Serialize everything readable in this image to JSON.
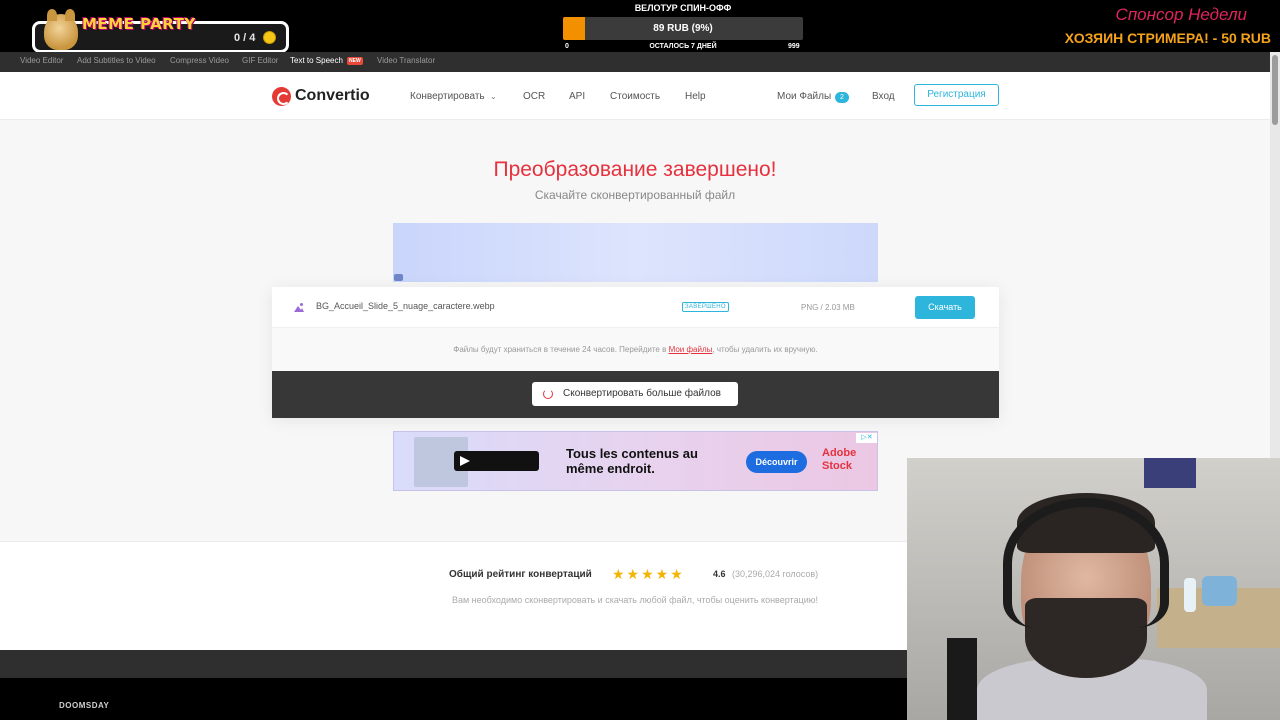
{
  "overlay": {
    "meme_title": "MEME PARTY",
    "meme_count": "0 / 4",
    "spin_title": "ВЕЛОТУР СПИН-ОФФ",
    "spin_text": "89 RUB (9%)",
    "spin_progress_fraction": 0.09,
    "spin_min": "0",
    "spin_remaining": "ОСТАЛОСЬ 7 ДНЕЙ",
    "spin_max": "999",
    "sponsor_title": "Спонсор Недели",
    "sponsor_text": "ХОЗЯИН СТРИМЕРА! - 50 RUB",
    "bottom_logo": "DOOMSDAY"
  },
  "subnav": {
    "items": [
      "Video Editor",
      "Add Subtitles to Video",
      "Compress Video",
      "GIF Editor",
      "Text to Speech",
      "Video Translator"
    ],
    "new_badge": "NEW",
    "active_item": "Text to Speech"
  },
  "header": {
    "logo": "Convertio",
    "nav": [
      "Конвертировать",
      "OCR",
      "API",
      "Стоимость",
      "Help"
    ],
    "my_files": "Мои Файлы",
    "my_files_count": "2",
    "login": "Вход",
    "register": "Регистрация"
  },
  "main": {
    "title": "Преобразование завершено!",
    "subtitle": "Скачайте сконвертированный файл"
  },
  "file": {
    "name": "BG_Accueil_Slide_5_nuage_caractere.webp",
    "status": "ЗАВЕРШЕНО",
    "size": "PNG / 2.03 MB",
    "download": "Скачать"
  },
  "storage": {
    "prefix": "Файлы будут храниться в течение 24 часов. Перейдите в ",
    "link": "Мои файлы",
    "suffix": ", чтобы удалить их вручную."
  },
  "convert_more": "Сконвертировать больше файлов",
  "ad": {
    "headline": "Tous les contenus au même endroit.",
    "cta": "Découvrir",
    "brand": "Adobe Stock"
  },
  "rating": {
    "label": "Общий рейтинг конвертаций",
    "value": "4.6",
    "votes": "(30,296,024 голосов)",
    "stars": "★★★★★",
    "note": "Вам необходимо сконвертировать и скачать любой файл, чтобы оценить конвертацию!"
  },
  "colors": {
    "accent_red": "#e5323e",
    "accent_blue": "#2eb5dc",
    "progress_orange": "#f39000",
    "sponsor_pink": "#e0245e",
    "sponsor_orange": "#f5a21b"
  }
}
